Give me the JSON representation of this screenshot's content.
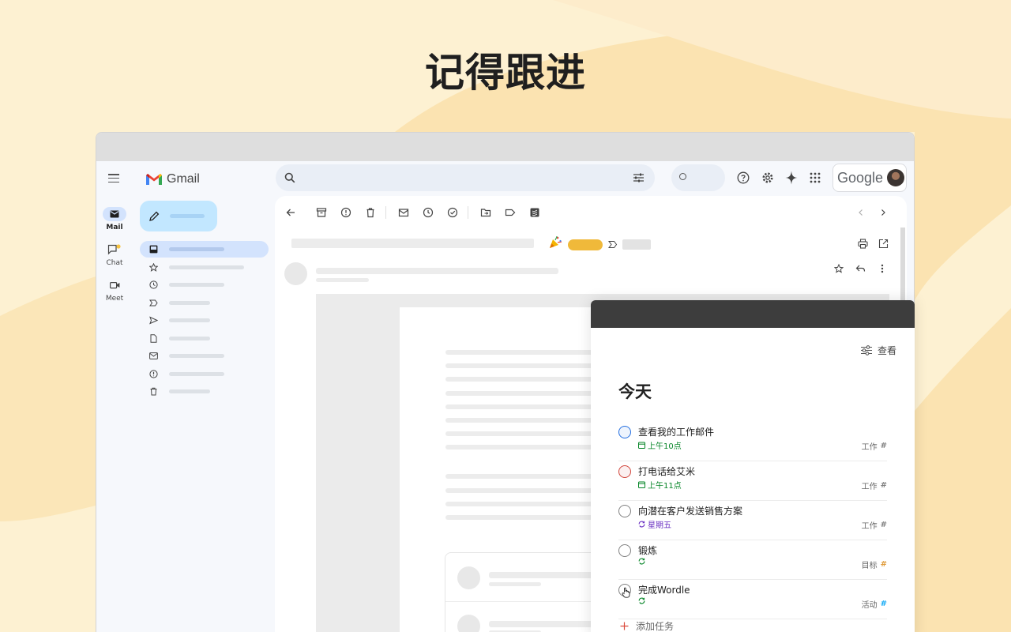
{
  "headline": "记得跟进",
  "colors": {
    "background": "#fdf1d2",
    "wave": "#fbe3b1",
    "accent": "#dc4c3e",
    "gmail_blue": "#d3e3fd"
  },
  "gmail": {
    "app_name": "Gmail",
    "rail": [
      {
        "label": "Mail",
        "icon": "mail-icon",
        "active": true
      },
      {
        "label": "Chat",
        "icon": "chat-icon",
        "active": false
      },
      {
        "label": "Meet",
        "icon": "video-icon",
        "active": false
      }
    ],
    "header_icons": [
      "help-icon",
      "settings-icon",
      "gemini-sparkle-icon",
      "apps-grid-icon"
    ],
    "account_brand": "Google"
  },
  "todoist": {
    "view_label": "查看",
    "title": "今天",
    "tasks": [
      {
        "name": "查看我的工作邮件",
        "meta": "上午10点",
        "meta_type": "date",
        "meta_color": "#058527",
        "priority_color": "#246fe0",
        "project": "工作",
        "project_color": "#808080"
      },
      {
        "name": "打电话给艾米",
        "meta": "上午11点",
        "meta_type": "date",
        "meta_color": "#058527",
        "priority_color": "#d1453b",
        "project": "工作",
        "project_color": "#808080"
      },
      {
        "name": "向潜在客户发送销售方案",
        "meta": "星期五",
        "meta_type": "recurring",
        "meta_color": "#692fc2",
        "priority_color": "#808080",
        "project": "工作",
        "project_color": "#808080"
      },
      {
        "name": "锻炼",
        "meta": "",
        "meta_type": "recurring",
        "meta_color": "#058527",
        "priority_color": "#808080",
        "project": "目标",
        "project_color": "#e09d3e"
      },
      {
        "name": "完成Wordle",
        "meta": "",
        "meta_type": "recurring",
        "meta_color": "#058527",
        "priority_color": "#808080",
        "project": "活动",
        "project_color": "#14aaf5"
      }
    ],
    "add_task_label": "添加任务"
  }
}
